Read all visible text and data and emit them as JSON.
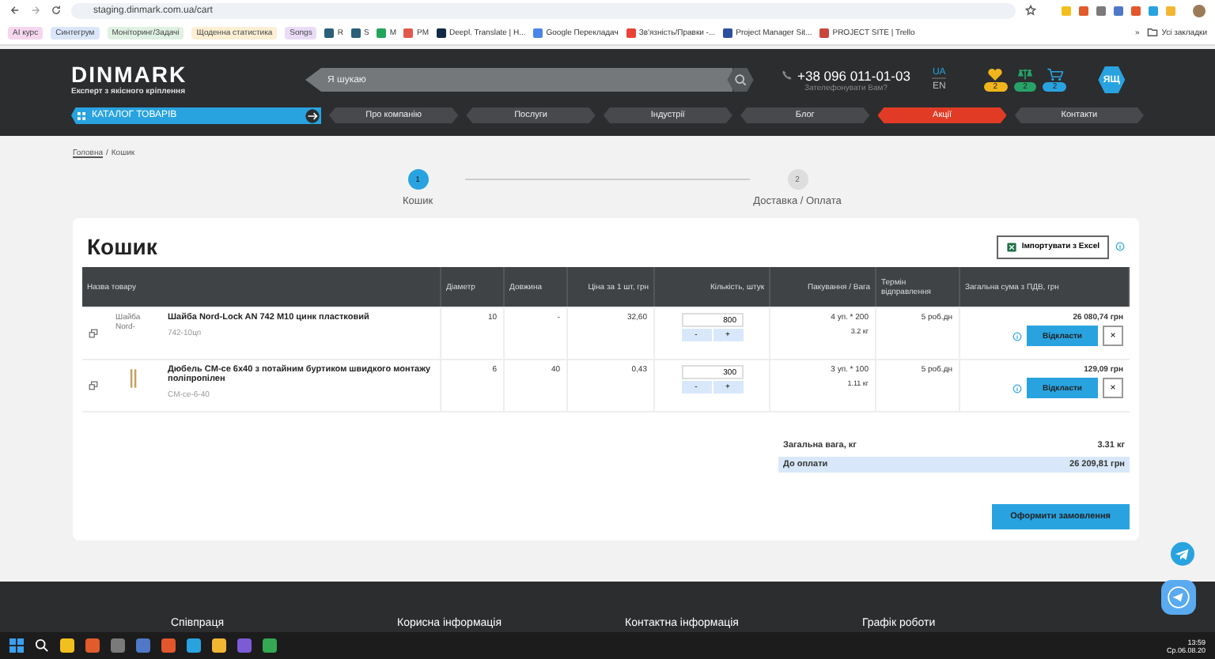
{
  "browser": {
    "url": "staging.dinmark.com.ua/cart",
    "bookmarks": [
      {
        "label": "AI курс",
        "kind": "chip",
        "color": "#f6d6ee"
      },
      {
        "label": "Синтегрум",
        "kind": "chip",
        "color": "#dbe6fb"
      },
      {
        "label": "Моніторинг/Задачі",
        "kind": "chip",
        "color": "#dff1e3"
      },
      {
        "label": "Щоденна статистика",
        "kind": "chip",
        "color": "#fcefd4"
      },
      {
        "label": "Songs",
        "kind": "chip",
        "color": "#eadcf7"
      },
      {
        "label": "R",
        "kind": "icon",
        "color": "#2b5f7a"
      },
      {
        "label": "S",
        "kind": "icon",
        "color": "#2b5f7a"
      },
      {
        "label": "M",
        "kind": "icon",
        "color": "#21a65b"
      },
      {
        "label": "PM",
        "kind": "icon",
        "color": "#e2574c"
      },
      {
        "label": "Deepl. Translate | Н...",
        "kind": "icon",
        "color": "#0f2b46"
      },
      {
        "label": "Google Перекладач",
        "kind": "icon",
        "color": "#4a86e8"
      },
      {
        "label": "Зв'язність/Правки -...",
        "kind": "icon",
        "color": "#ea4335"
      },
      {
        "label": "Project Manager Sit...",
        "kind": "icon",
        "color": "#2d4fa0"
      },
      {
        "label": "PROJECT SITE | Trello",
        "kind": "icon",
        "color": "#c9463d"
      }
    ],
    "overflow": "»",
    "all_bookmarks": "Усі закладки"
  },
  "header": {
    "logo": "DINMARK",
    "tagline": "Експерт з якісного кріплення",
    "search_placeholder": "Я шукаю",
    "phone": "+38 096 011-01-03",
    "callback": "Зателефонувати Вам?",
    "languages": [
      {
        "label": "UA",
        "selected": true
      },
      {
        "label": "EN",
        "selected": false
      }
    ],
    "counters": [
      {
        "kind": "heart",
        "count": "2",
        "color": "#f0b41c"
      },
      {
        "kind": "scales",
        "count": "2",
        "color": "#27a36a"
      },
      {
        "kind": "cart",
        "count": "2",
        "color": "#29a3e0"
      }
    ],
    "user": "ЯЩ",
    "catalog": "КАТАЛОГ ТОВАРІВ",
    "nav": [
      {
        "label": "Про компанію",
        "kind": "normal"
      },
      {
        "label": "Послуги",
        "kind": "normal"
      },
      {
        "label": "Індустрії",
        "kind": "normal"
      },
      {
        "label": "Блог",
        "kind": "normal"
      },
      {
        "label": "Акції",
        "kind": "promo"
      },
      {
        "label": "Контакти",
        "kind": "normal"
      }
    ]
  },
  "breadcrumb_separator": "/",
  "breadcrumb": [
    {
      "label": "Головна",
      "link": true
    },
    {
      "label": "Кошик",
      "link": false
    }
  ],
  "steps": [
    {
      "number": "1",
      "label": "Кошик",
      "selected": true
    },
    {
      "number": "2",
      "label": "Доставка / Оплата",
      "selected": false
    }
  ],
  "cart": {
    "title": "Кошик",
    "import_button": "Імпортувати з Excel",
    "columns": [
      "Назва товару",
      "Діаметр",
      "Довжина",
      "Ціна за 1 шт, грн",
      "Кількість, штук",
      "Пакування / Вага",
      "Термін відправлення",
      "Загальна сума з ПДВ, грн"
    ],
    "rows": [
      {
        "image": {
          "kind": "broken",
          "alt": "Шайба Nord-"
        },
        "name": "Шайба Nord-Lock AN 742 M10 цинк пластковий",
        "sku": "742-10цп",
        "diameter": "10",
        "length": "-",
        "price": "32,60",
        "quantity": "800",
        "packaging": "4 уп. * 200",
        "weight": "3.2 кг",
        "delivery": "5 роб.дн",
        "total": "26 080,74 грн",
        "postpone": "Відкласти",
        "remove": "×"
      },
      {
        "image": {
          "kind": "drawing"
        },
        "name": "Дюбель CM-ce 6x40 з потайним буртиком швидкого монтажу поліпропілен",
        "sku": "CM-ce-6-40",
        "diameter": "6",
        "length": "40",
        "price": "0,43",
        "quantity": "300",
        "packaging": "3 уп. * 100",
        "weight": "1.11 кг",
        "delivery": "5 роб.дн",
        "total": "129,09 грн",
        "postpone": "Відкласти",
        "remove": "×"
      }
    ],
    "minus": "-",
    "plus": "+",
    "weight_label": "Загальна вага, кг",
    "weight": "3.31 кг",
    "pay_label": "До оплати",
    "pay": "26 209,81 грн",
    "checkout": "Оформити замовлення"
  },
  "footer": [
    "Співпраця",
    "Корисна інформація",
    "Контактна інформація",
    "Графік роботи"
  ],
  "taskbar": {
    "time": "13:59",
    "date": "Ср.06.08.20"
  }
}
